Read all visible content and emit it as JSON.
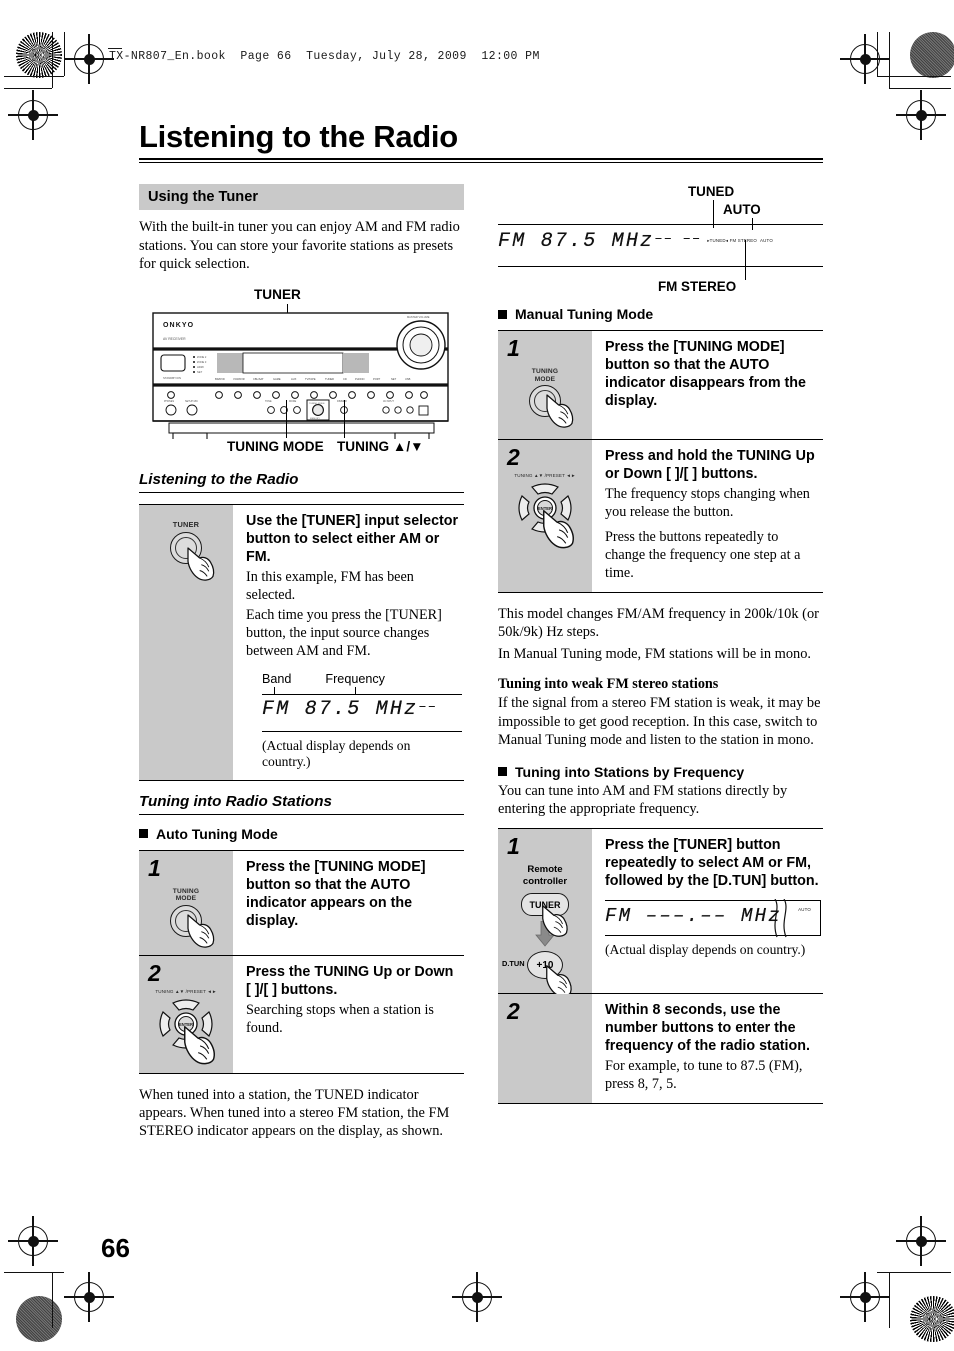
{
  "book_header": "TX-NR807_En.book  Page 66  Tuesday, July 28, 2009  12:00 PM",
  "page_title": "Listening to the Radio",
  "page_number": "66",
  "left_column": {
    "section_heading": "Using the Tuner",
    "intro_paragraph": "With the built-in tuner you can enjoy AM and FM radio stations. You can store your favorite stations as presets for quick selection.",
    "receiver_diagram": {
      "top_callout": "TUNER",
      "bottom_callout_left": "TUNING MODE",
      "bottom_callout_right": "TUNING ▲/▼",
      "brand": "ONKYO"
    },
    "subsection_1_title": "Listening to the Radio",
    "step_tuner": {
      "number": "1",
      "button_label": "TUNER",
      "title": "Use the [TUNER] input selector button to select either AM or FM.",
      "text_1": "In this example, FM has been selected.",
      "text_2": "Each time you press the [TUNER] button, the input source changes between AM and FM.",
      "display": {
        "label_band": "Band",
        "label_frequency": "Frequency",
        "text": "FM 87.5 MHz",
        "dashes": "––",
        "caption": "(Actual display depends on country.)"
      }
    },
    "subsection_2_title": "Tuning into Radio Stations",
    "auto_tuning_heading": "Auto Tuning Mode",
    "auto_steps": [
      {
        "number": "1",
        "button_label": "TUNING\nMODE",
        "icon": "round-button",
        "title": "Press the [TUNING MODE] button so that the AUTO indicator appears on the display.",
        "text": ""
      },
      {
        "number": "2",
        "button_label": "TUNING ▲▼ /PRESET ◄►",
        "icon": "dpad",
        "title": "Press the TUNING Up or Down [   ]/[   ] buttons.",
        "text": "Searching stops when a station is found."
      }
    ],
    "closing_paragraph": "When tuned into a station, the TUNED indicator appears. When tuned into a stereo FM station, the FM STEREO indicator appears on the display, as shown."
  },
  "right_column": {
    "display_top": {
      "text": "FM 87.5 MHz",
      "dashes": "–– ––",
      "micro_indicators": "▸TUNED◂ FM STEREO",
      "micro_auto": "AUTO",
      "callout_tuned": "TUNED",
      "callout_auto": "AUTO",
      "callout_fm_stereo": "FM STEREO"
    },
    "manual_tuning_heading": "Manual Tuning Mode",
    "manual_steps": [
      {
        "number": "1",
        "button_label": "TUNING\nMODE",
        "icon": "round-button",
        "title": "Press the [TUNING MODE] button so that the AUTO indicator disappears from the display.",
        "text_1": "",
        "text_2": ""
      },
      {
        "number": "2",
        "button_label": "TUNING ▲▼ /PRESET ◄►",
        "icon": "dpad",
        "title": "Press and hold the TUNING Up or Down [   ]/[   ] buttons.",
        "text_1": "The frequency stops changing when you release the button.",
        "text_2": "Press the buttons repeatedly to change the frequency one step at a time."
      }
    ],
    "paragraph_1": "This model changes FM/AM frequency in 200k/10k (or 50k/9k) Hz steps.",
    "paragraph_2": "In Manual Tuning mode, FM stations will be in mono.",
    "weak_fm_heading": "Tuning into weak FM stereo stations",
    "weak_fm_text": "If the signal from a stereo FM station is weak, it may be impossible to get good reception. In this case, switch to Manual Tuning mode and listen to the station in mono.",
    "by_frequency_heading": "Tuning into Stations by Frequency",
    "by_frequency_text": "You can tune into AM and FM stations directly by entering the appropriate frequency.",
    "freq_steps": [
      {
        "number": "1",
        "remote_label": "Remote\ncontroller",
        "button_tuner": "TUNER",
        "button_plus10": "+10",
        "button_dtun": "D.TUN",
        "title": "Press the [TUNER] button repeatedly to select AM or FM, followed by the [D.TUN] button.",
        "display_text": "FM –––.–– MHz",
        "display_auto": "AUTO",
        "caption": "(Actual display depends on country.)"
      },
      {
        "number": "2",
        "title": "Within 8 seconds, use the number buttons to enter the frequency of the radio station.",
        "text": "For example, to tune to 87.5 (FM), press 8, 7, 5."
      }
    ]
  }
}
